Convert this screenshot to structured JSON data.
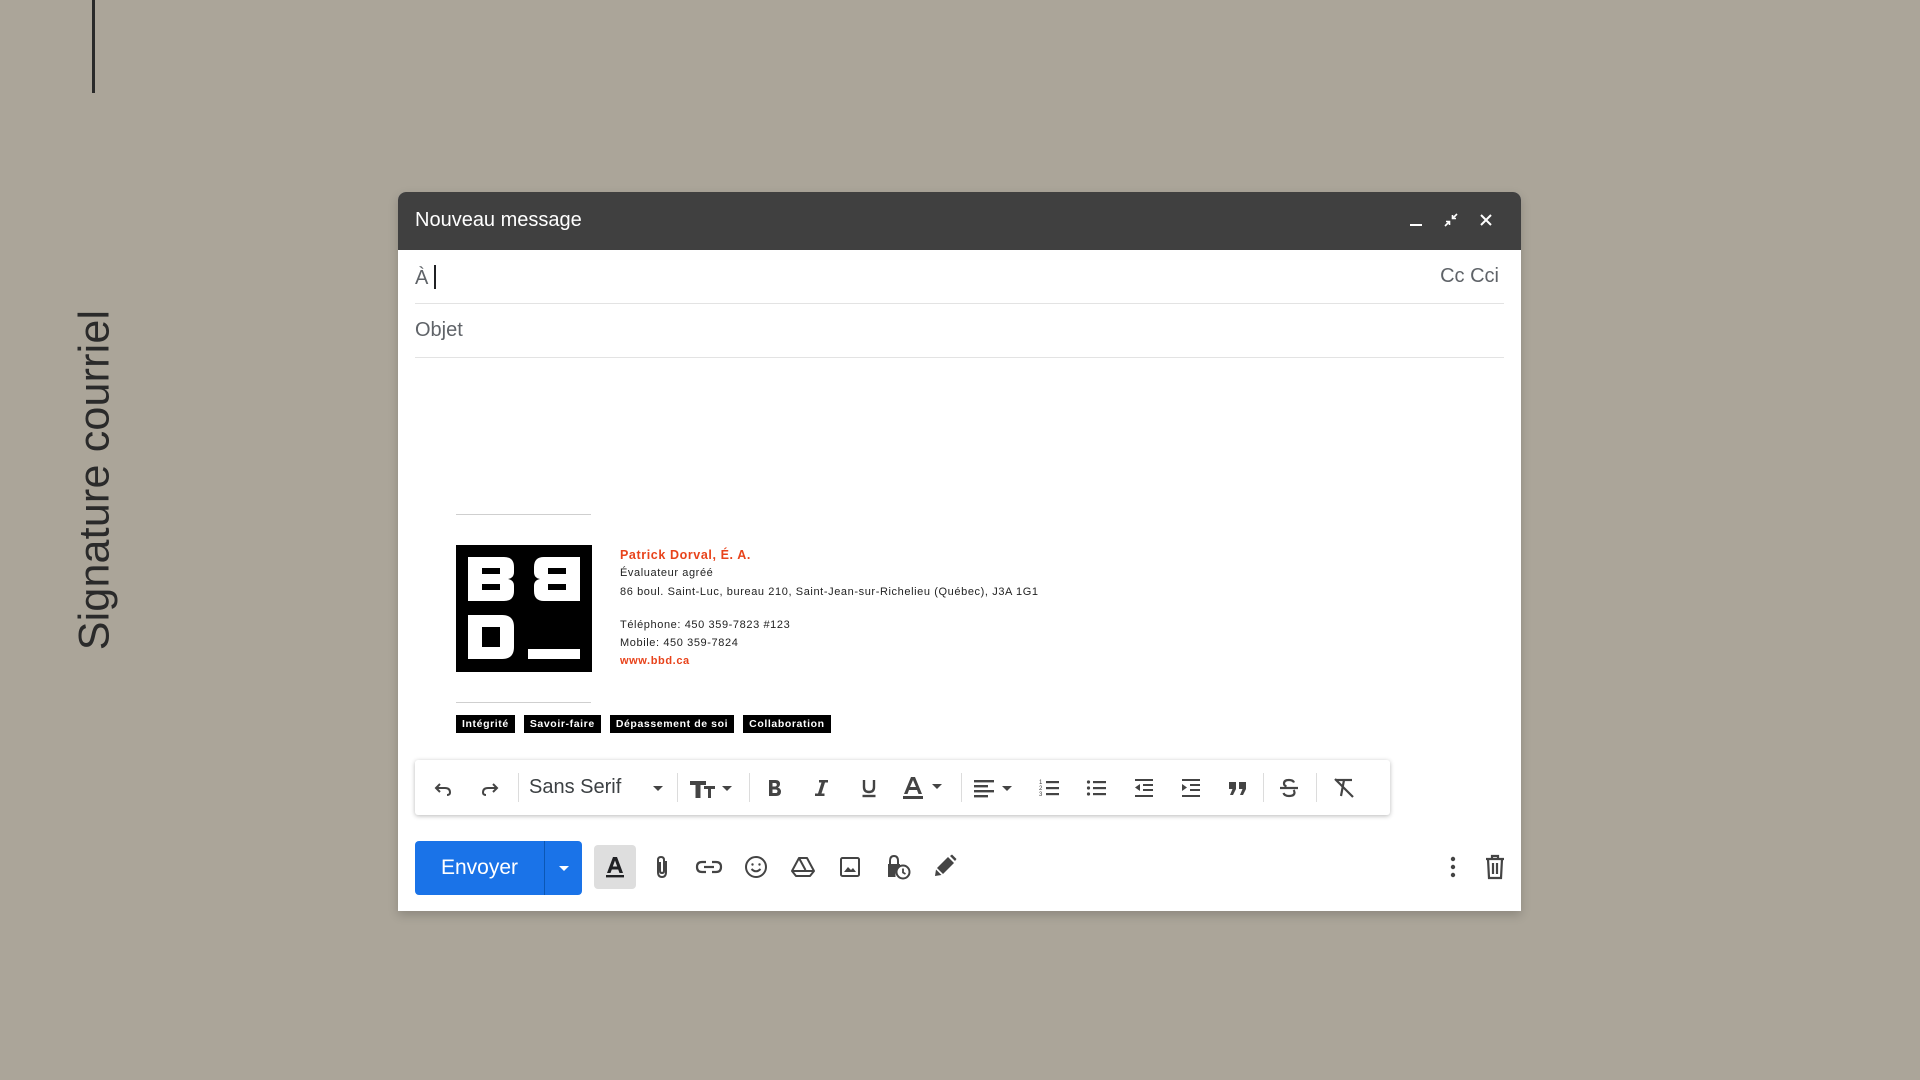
{
  "side": {
    "title": "Signature courriel"
  },
  "compose": {
    "title": "Nouveau message",
    "to_label": "À",
    "cc_label": "Cc Cci",
    "subject_label": "Objet",
    "window_icons": [
      "minimize-icon",
      "exit-fullscreen-icon",
      "close-icon"
    ]
  },
  "signature": {
    "logo_text": "BBD_",
    "name": "Patrick Dorval, É. A.",
    "role": "Évaluateur agréé",
    "address": "86 boul. Saint-Luc, bureau 210, Saint-Jean-sur-Richelieu (Québec), J3A 1G1",
    "phone": "Téléphone: 450 359-7823 #123",
    "mobile": "Mobile: 450 359-7824",
    "website": "www.bbd.ca",
    "accent_color": "#e8431b",
    "tags": [
      "Intégrité",
      "Savoir-faire",
      "Dépassement de soi",
      "Collaboration"
    ]
  },
  "formatting": {
    "font": "Sans Serif",
    "icons": [
      "undo-icon",
      "redo-icon",
      "font-dropdown-icon",
      "text-size-icon",
      "bold-icon",
      "italic-icon",
      "underline-icon",
      "text-color-icon",
      "align-icon",
      "numbered-list-icon",
      "bulleted-list-icon",
      "indent-less-icon",
      "indent-more-icon",
      "quote-icon",
      "strikethrough-icon",
      "remove-formatting-icon"
    ]
  },
  "bottom": {
    "send_label": "Envoyer",
    "send_color": "#1a73e8",
    "icons": [
      "formatting-options-icon",
      "attach-icon",
      "link-icon",
      "emoji-icon",
      "drive-icon",
      "photo-icon",
      "confidential-mode-icon",
      "signature-icon",
      "more-options-icon",
      "trash-icon"
    ]
  }
}
